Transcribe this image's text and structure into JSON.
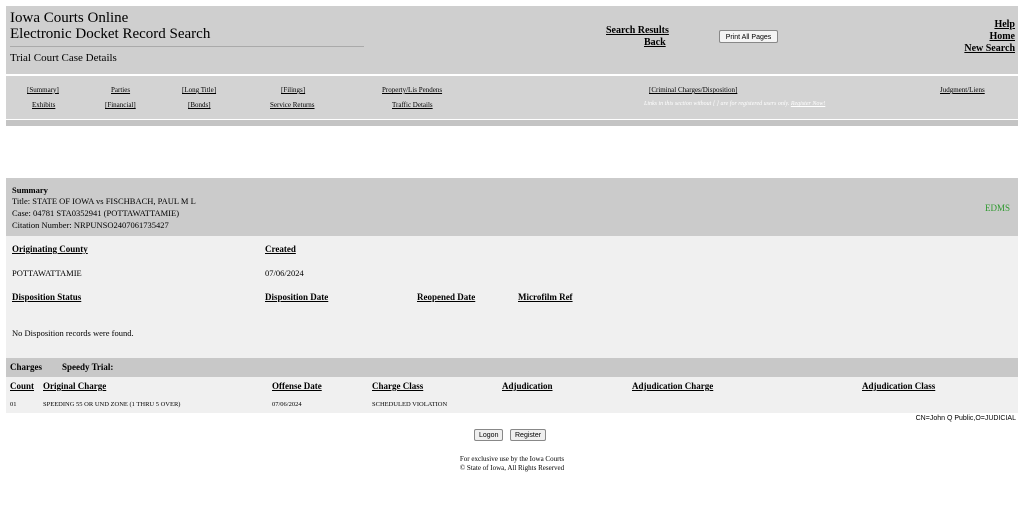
{
  "header": {
    "title_line1": "Iowa Courts Online",
    "title_line2": "Electronic Docket Record Search",
    "subtitle": "Trial Court Case Details",
    "search_results": "Search Results",
    "back": "Back",
    "print_all": "Print All Pages",
    "help": "Help",
    "home": "Home",
    "new_search": "New Search"
  },
  "tabs": {
    "row1": [
      "[Summary]",
      "Parties",
      "[Long Title]",
      "[Filings]",
      "Property/Lis Pendens",
      "[Criminal Charges/Disposition]",
      "Judgment/Liens"
    ],
    "row2": [
      "Exhibits",
      "[Financial]",
      "[Bonds]",
      "Service Returns",
      "Traffic Details"
    ],
    "note": "Links in this section without [ ] are for registered users only.",
    "register_now": "Register Now!"
  },
  "summary": {
    "heading": "Summary",
    "title": "Title: STATE OF IOWA vs FISCHBACH, PAUL M L",
    "case": "Case: 04781 STA0352941 (POTTAWATTAMIE)",
    "citation": "Citation Number: NRPUNSO2407061735427",
    "edms": "EDMS"
  },
  "details": {
    "originating_county_label": "Originating County",
    "originating_county": "POTTAWATTAMIE",
    "created_label": "Created",
    "created": "07/06/2024",
    "disposition_status_label": "Disposition Status",
    "disposition_date_label": "Disposition Date",
    "reopened_date_label": "Reopened Date",
    "microfilm_ref_label": "Microfilm Ref",
    "no_records": "No Disposition records were found."
  },
  "charges": {
    "label": "Charges",
    "speedy_trial": "Speedy Trial:",
    "columns": [
      "Count",
      "Original Charge",
      "Offense Date",
      "Charge Class",
      "Adjudication",
      "Adjudication Charge",
      "Adjudication Class"
    ],
    "rows": [
      {
        "count": "01",
        "original_charge": "SPEEDING 55 OR UND ZONE (1 THRU 5 OVER)",
        "offense_date": "07/06/2024",
        "charge_class": "SCHEDULED VIOLATION",
        "adjudication": "",
        "adjudication_charge": "",
        "adjudication_class": ""
      }
    ]
  },
  "cert": "CN=John Q Public,O=JUDICIAL",
  "buttons": {
    "logon": "Logon",
    "register": "Register"
  },
  "footer": {
    "line1": "For exclusive use by the Iowa Courts",
    "line2": "© State of Iowa,  All Rights Reserved"
  }
}
